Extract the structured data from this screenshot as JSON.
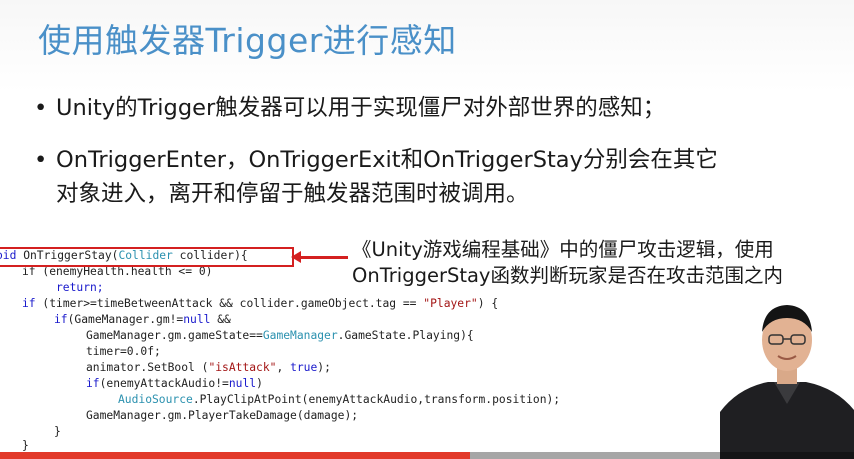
{
  "slide": {
    "title": "使用触发器Trigger进行感知",
    "bullets": [
      {
        "dot": "•",
        "text": "Unity的Trigger触发器可以用于实现僵尸对外部世界的感知；"
      },
      {
        "dot": "•",
        "text": "OnTriggerEnter，OnTriggerExit和OnTriggerStay分别会在其它",
        "continuation": "对象进入，离开和停留于触发器范围时被调用。"
      }
    ]
  },
  "code": {
    "l1_kw": "oid",
    "l1_a": " OnTriggerStay(",
    "l1_type": "Collider",
    "l1_b": " collider){",
    "l2": "if (enemyHealth.health <= 0)",
    "l3": "return;",
    "l4_kw": "if",
    "l4_a": " (timer>=timeBetweenAttack && collider.gameObject.tag == ",
    "l4_str": "\"Player\"",
    "l4_b": ") {",
    "l5_kw": "if",
    "l5_a": "(GameManager.gm!=",
    "l5_null": "null",
    "l5_b": " &&",
    "l6_a": "GameManager.gm.gameState==",
    "l6_type": "GameManager",
    "l6_b": ".GameState.Playing){",
    "l7": "timer=0.0f;",
    "l8_a": "animator.SetBool (",
    "l8_str": "\"isAttack\"",
    "l8_b": ", ",
    "l8_true": "true",
    "l8_c": ");",
    "l9_kw": "if",
    "l9_a": "(enemyAttackAudio!=",
    "l9_null": "null",
    "l9_b": ")",
    "l10_type": "AudioSource",
    "l10_a": ".PlayClipAtPoint(enemyAttackAudio,transform.position);",
    "l11": "GameManager.gm.PlayerTakeDamage(damage);",
    "l12": "}",
    "l13": "}"
  },
  "annotation": {
    "line1": "《Unity游戏编程基础》中的僵尸攻击逻辑，使用",
    "line2": "OnTriggerStay函数判断玩家是否在攻击范围之内"
  },
  "colors": {
    "title": "#4a90c8",
    "highlight": "#d42020",
    "keyword": "#1a1acc",
    "type": "#2b91af",
    "string": "#a31515",
    "progress": "#e23a2a"
  },
  "video": {
    "progress_fraction": 0.55,
    "presenter": "presenter-video"
  }
}
